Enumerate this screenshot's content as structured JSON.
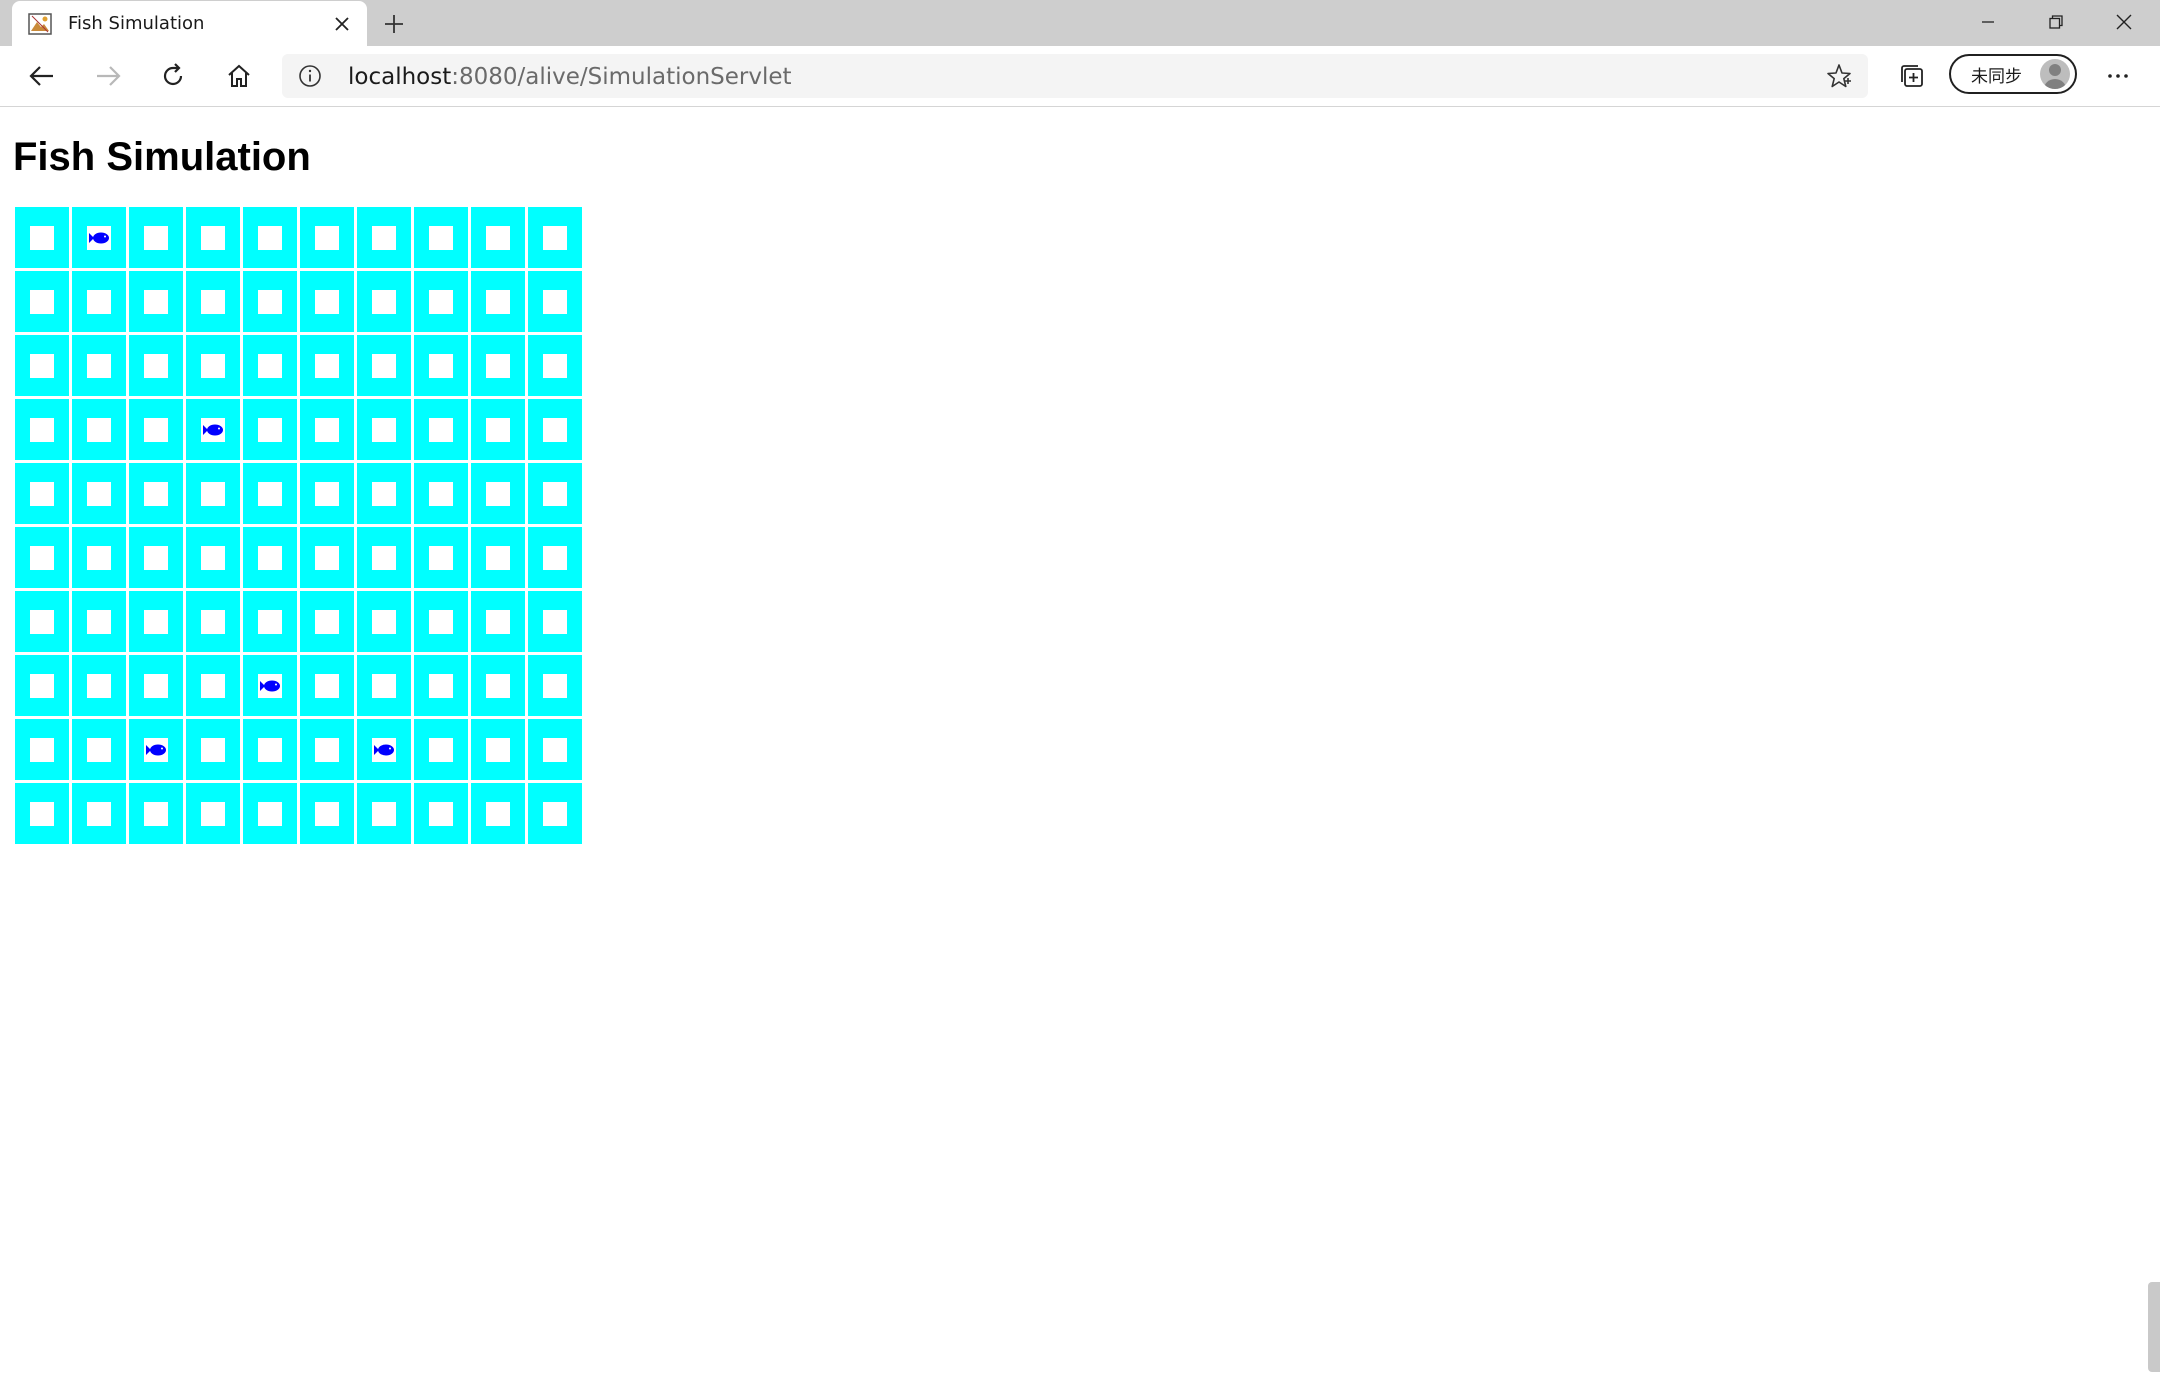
{
  "browser": {
    "tab": {
      "title": "Fish Simulation",
      "favicon": "picture-icon",
      "close_icon": "close-icon"
    },
    "new_tab_icon": "plus-icon",
    "window_controls": [
      "minimize-icon",
      "restore-icon",
      "close-icon"
    ],
    "nav": [
      "back-icon",
      "forward-icon",
      "refresh-icon",
      "home-icon"
    ],
    "address": {
      "host": "localhost",
      "rest": ":8080/alive/SimulationServlet",
      "info_icon": "info-icon",
      "favorite_icon": "star-icon"
    },
    "collections_icon": "collections-icon",
    "profile": {
      "label": "未同步",
      "avatar_icon": "person-icon"
    },
    "menu_icon": "ellipsis-icon"
  },
  "page": {
    "title": "Fish Simulation"
  },
  "simulation": {
    "rows": 10,
    "cols": 10,
    "water_color": "#00ffff",
    "fish_color": "#0000ff",
    "fish": [
      {
        "row": 0,
        "col": 1
      },
      {
        "row": 3,
        "col": 3
      },
      {
        "row": 7,
        "col": 4
      },
      {
        "row": 8,
        "col": 2
      },
      {
        "row": 8,
        "col": 6
      }
    ]
  }
}
